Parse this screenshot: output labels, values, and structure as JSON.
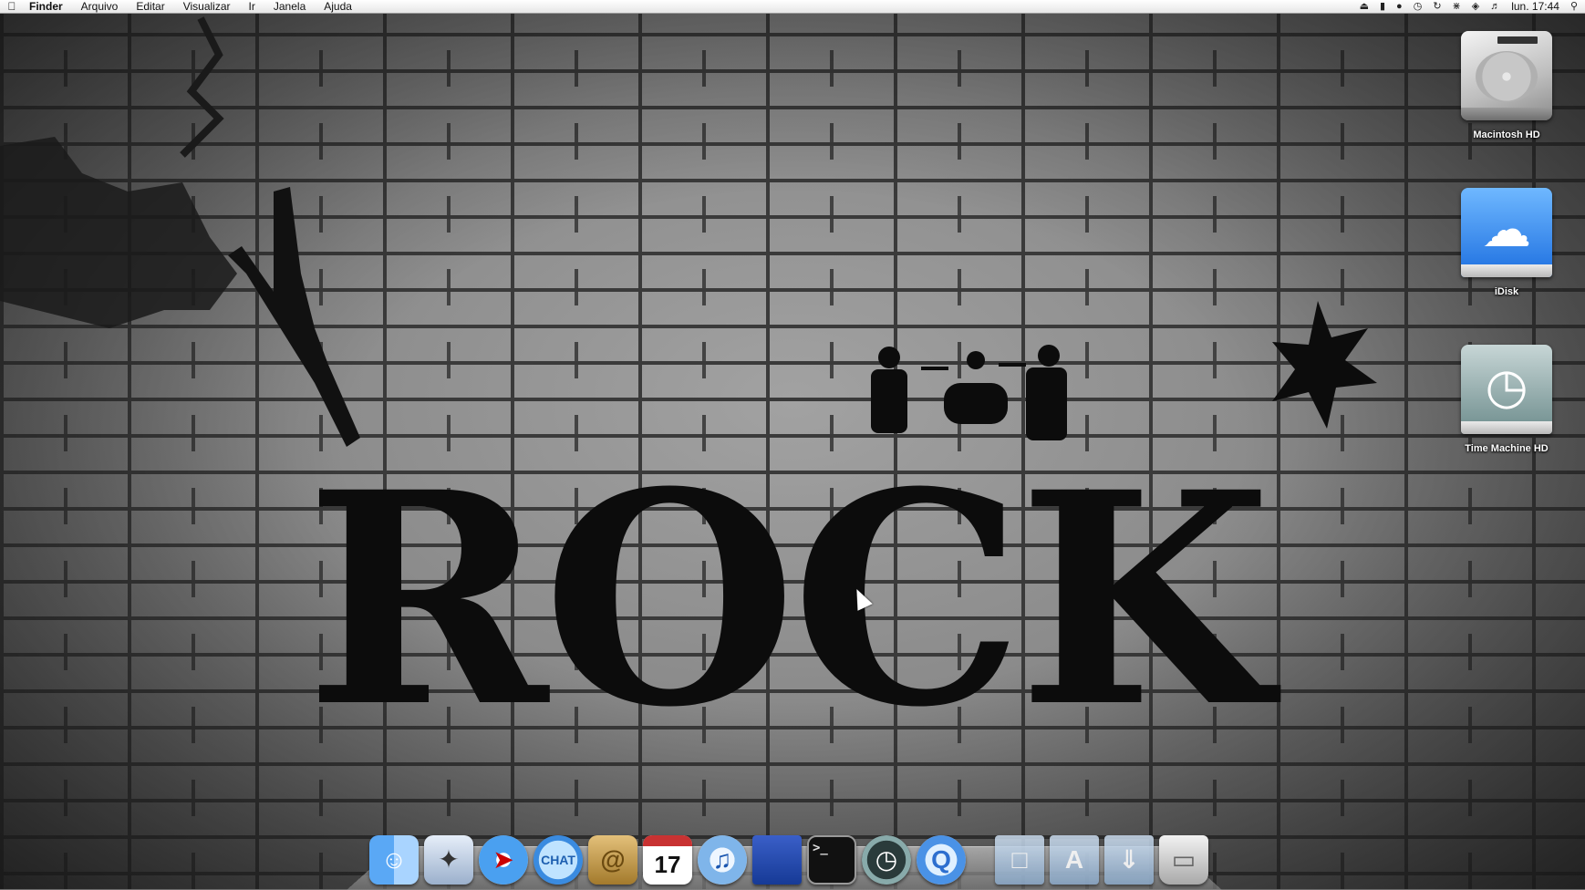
{
  "menubar": {
    "app_name": "Finder",
    "menus": [
      "Arquivo",
      "Editar",
      "Visualizar",
      "Ir",
      "Janela",
      "Ajuda"
    ],
    "clock": "lun. 17:44",
    "status_icons": [
      "eject-icon",
      "battery-icon",
      "user-icon",
      "time-machine-icon",
      "sync-icon",
      "bluetooth-icon",
      "wifi-icon",
      "volume-icon",
      "spotlight-icon"
    ]
  },
  "wallpaper": {
    "text": "ROCK"
  },
  "desktop_icons": [
    {
      "label": "Macintosh HD",
      "icon": "hard-drive-icon"
    },
    {
      "label": "iDisk",
      "icon": "idisk-icon"
    },
    {
      "label": "Time Machine HD",
      "icon": "time-machine-drive-icon"
    }
  ],
  "dock": {
    "calendar_day": "17",
    "terminal_prompt": ">_",
    "ichat_text": "CHAT",
    "items": [
      "finder-icon",
      "mail-icon",
      "safari-icon",
      "ichat-icon",
      "address-book-icon",
      "ical-icon",
      "itunes-icon",
      "app-icon",
      "terminal-icon",
      "time-machine-icon",
      "quicktime-icon",
      "documents-stack-icon",
      "applications-stack-icon",
      "downloads-stack-icon",
      "trash-icon"
    ]
  }
}
